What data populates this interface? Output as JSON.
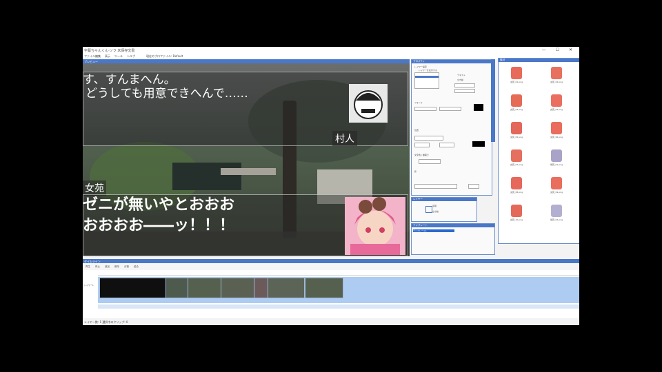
{
  "window": {
    "title": "字幕ちゃんくん-ソラ 未保存文書",
    "controls": "— ☐ ✕"
  },
  "menu": {
    "items": [
      "ファイル",
      "編集",
      "表示",
      "ツール",
      "ヘルプ"
    ],
    "profile": "現在のプロファイル: Default"
  },
  "preview": {
    "header": "プレビュー",
    "line1": "す、すんまへん。",
    "line2": "どうしても用意できへんで……",
    "speaker1": "村人",
    "speaker2": "女苑",
    "line3": "ゼニが無いやとおおお",
    "line4": "おおおお――ッ！！！"
  },
  "properties": {
    "header": "プロパティ",
    "section1": "レイヤー設定",
    "option1": "レイヤーを表示する",
    "option2": "テキスト",
    "option3": "立ち絵",
    "section2": "フォント",
    "section3": "位置",
    "section4": "文字色 / 縁取り",
    "section5": "影"
  },
  "small_panel": {
    "header": "レイヤー",
    "item1": "字幕",
    "item2": "立ち絵"
  },
  "bottom_panel": {
    "header": "テンプレート",
    "selected": "テンプレート1"
  },
  "assets": {
    "header": "素材",
    "items": [
      {
        "caption": "女苑_01.png",
        "color": "#e86a5a"
      },
      {
        "caption": "女苑_02.png",
        "color": "#e8705e"
      },
      {
        "caption": "女苑_03.png",
        "color": "#e56b57"
      },
      {
        "caption": "女苑_04.png",
        "color": "#ea6f60"
      },
      {
        "caption": "女苑_05.png",
        "color": "#e3675a"
      },
      {
        "caption": "女苑_06.png",
        "color": "#e96c5c"
      },
      {
        "caption": "女苑_07.png",
        "color": "#e5705f"
      },
      {
        "caption": "紫苑_01.png",
        "color": "#a9a3c8"
      },
      {
        "caption": "女苑_08.png",
        "color": "#e6685c"
      },
      {
        "caption": "女苑_09.png",
        "color": "#e96e5e"
      },
      {
        "caption": "女苑_10.png",
        "color": "#e36a58"
      },
      {
        "caption": "紫苑_02.png",
        "color": "#b3afd0"
      }
    ]
  },
  "timeline": {
    "header": "タイムライン",
    "tools": [
      "再生",
      "停止",
      "追加",
      "削除",
      "分割",
      "結合"
    ],
    "track_label": "レイヤー1"
  },
  "status": {
    "text": "レイヤー数: 1 選択中のクリップ: 0"
  }
}
